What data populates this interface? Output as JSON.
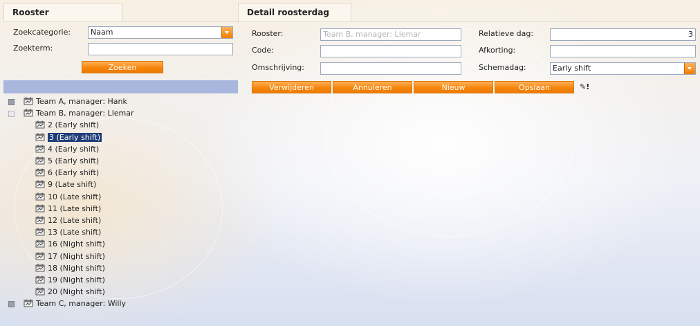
{
  "left_pane": {
    "tab_title": "Rooster",
    "search": {
      "category_label": "Zoekcategorie:",
      "category_value": "Naam",
      "term_label": "Zoekterm:",
      "term_value": "",
      "search_button": "Zoeken"
    },
    "tree": [
      {
        "label": "Team A, manager: Hank",
        "level": 0,
        "expander": "plus"
      },
      {
        "label": "Team B, manager: Llemar",
        "level": 0,
        "expander": "minus"
      },
      {
        "label": "2 (Early shift)",
        "level": 1
      },
      {
        "label": "3 (Early shift)",
        "level": 1,
        "selected": true
      },
      {
        "label": "4 (Early shift)",
        "level": 1
      },
      {
        "label": "5 (Early shift)",
        "level": 1
      },
      {
        "label": "6 (Early shift)",
        "level": 1
      },
      {
        "label": "9 (Late shift)",
        "level": 1
      },
      {
        "label": "10 (Late shift)",
        "level": 1
      },
      {
        "label": "11 (Late shift)",
        "level": 1
      },
      {
        "label": "12 (Late shift)",
        "level": 1
      },
      {
        "label": "13 (Late shift)",
        "level": 1
      },
      {
        "label": "16 (Night shift)",
        "level": 1
      },
      {
        "label": "17 (Night shift)",
        "level": 1
      },
      {
        "label": "18 (Night shift)",
        "level": 1
      },
      {
        "label": "19 (Night shift)",
        "level": 1
      },
      {
        "label": "20 (Night shift)",
        "level": 1
      },
      {
        "label": "Team C, manager: Willy",
        "level": 0,
        "expander": "plus"
      }
    ]
  },
  "right_pane": {
    "tab_title": "Detail roosterdag",
    "fields": {
      "rooster_label": "Rooster:",
      "rooster_value": "Team B, manager: Llemar",
      "code_label": "Code:",
      "code_value": "",
      "omschrijving_label": "Omschrijving:",
      "omschrijving_value": "",
      "relatieve_dag_label": "Relatieve dag:",
      "relatieve_dag_value": "3",
      "afkorting_label": "Afkorting:",
      "afkorting_value": "",
      "schemadag_label": "Schemadag:",
      "schemadag_value": "Early shift"
    },
    "buttons": {
      "delete": "Verwijderen",
      "cancel": "Annuleren",
      "new": "Nieuw",
      "save": "Opslaan"
    },
    "edit_indicator": "✎!"
  },
  "colors": {
    "accent_orange": "#f5860c",
    "selection_blue": "#1f3d78",
    "bar_blue": "#a9b7de"
  }
}
